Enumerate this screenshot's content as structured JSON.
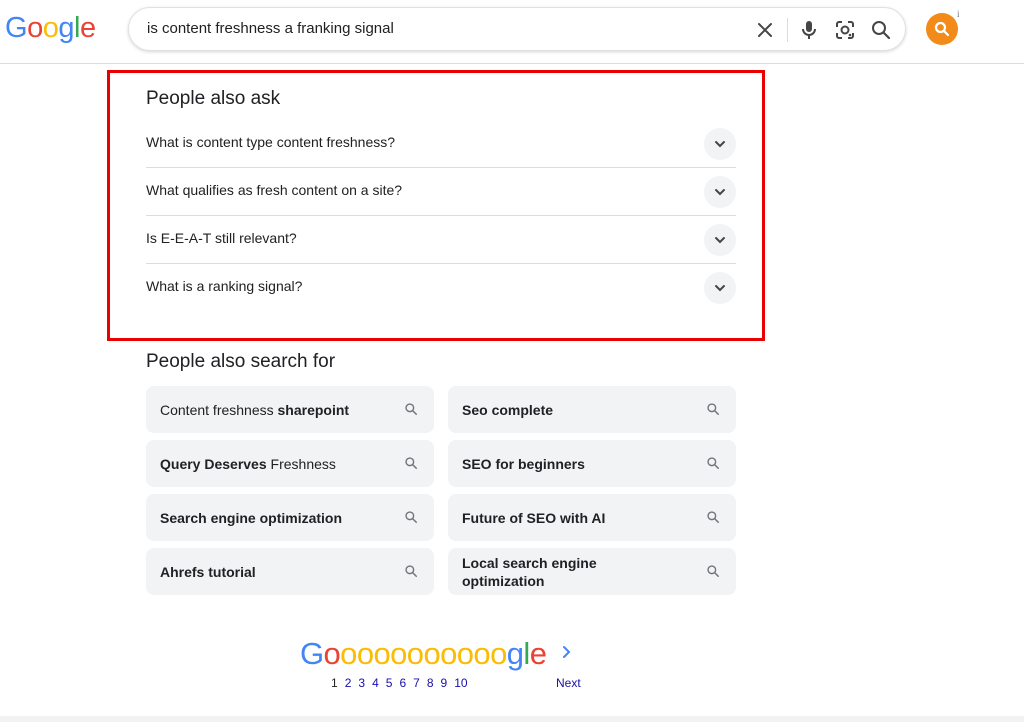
{
  "header": {
    "logo_letters": [
      {
        "ch": "G",
        "color": "#4285F4"
      },
      {
        "ch": "o",
        "color": "#EA4335"
      },
      {
        "ch": "o",
        "color": "#FBBC05"
      },
      {
        "ch": "g",
        "color": "#4285F4"
      },
      {
        "ch": "l",
        "color": "#34A853"
      },
      {
        "ch": "e",
        "color": "#EA4335"
      }
    ],
    "search_query": "is content freshness a franking signal",
    "icons": [
      "close-icon",
      "microphone-icon",
      "lens-icon",
      "search-icon"
    ],
    "avatar_info": "i",
    "avatar_color": "#f28b19"
  },
  "people_also_ask": {
    "title": "People also ask",
    "questions": [
      "What is content type content freshness?",
      "What qualifies as fresh content on a site?",
      "Is E-E-A-T still relevant?",
      "What is a ranking signal?"
    ],
    "highlight_color": "#ea0000"
  },
  "people_also_search_for": {
    "title": "People also search for",
    "chips": [
      {
        "plain": "Content freshness ",
        "bold": "sharepoint",
        "order": "plain-bold"
      },
      {
        "plain": "",
        "bold": "Seo complete",
        "order": "plain-bold"
      },
      {
        "plain": " Freshness",
        "bold": "Query Deserves",
        "order": "bold-plain"
      },
      {
        "plain": "",
        "bold": "SEO for beginners",
        "order": "plain-bold"
      },
      {
        "plain": "",
        "bold": "Search engine optimization",
        "order": "plain-bold"
      },
      {
        "plain": "",
        "bold": "Future of SEO with AI",
        "order": "plain-bold"
      },
      {
        "plain": "",
        "bold": "Ahrefs tutorial",
        "order": "plain-bold"
      },
      {
        "plain": "",
        "bold": "Local search engine optimization",
        "order": "plain-bold"
      }
    ]
  },
  "pagination": {
    "logo": [
      {
        "ch": "G",
        "color": "#4285F4"
      },
      {
        "ch": "o",
        "color": "#EA4335"
      },
      {
        "ch": "o",
        "color": "#FBBC05"
      },
      {
        "ch": "o",
        "color": "#FBBC05"
      },
      {
        "ch": "o",
        "color": "#FBBC05"
      },
      {
        "ch": "o",
        "color": "#FBBC05"
      },
      {
        "ch": "o",
        "color": "#FBBC05"
      },
      {
        "ch": "o",
        "color": "#FBBC05"
      },
      {
        "ch": "o",
        "color": "#FBBC05"
      },
      {
        "ch": "o",
        "color": "#FBBC05"
      },
      {
        "ch": "o",
        "color": "#FBBC05"
      },
      {
        "ch": "o",
        "color": "#FBBC05"
      },
      {
        "ch": "g",
        "color": "#4285F4"
      },
      {
        "ch": "l",
        "color": "#34A853"
      },
      {
        "ch": "e",
        "color": "#EA4335"
      }
    ],
    "pages": [
      "1",
      "2",
      "3",
      "4",
      "5",
      "6",
      "7",
      "8",
      "9",
      "10"
    ],
    "current_page": "1",
    "next_label": "Next"
  }
}
